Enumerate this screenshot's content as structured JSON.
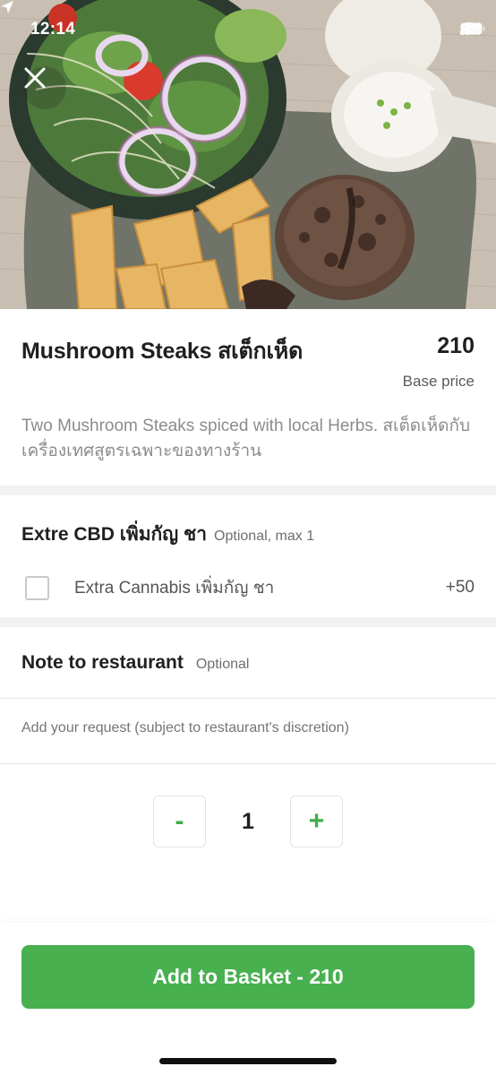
{
  "status_bar": {
    "time": "12:14"
  },
  "item": {
    "title": "Mushroom Steaks สเต็กเห็ด",
    "price": "210",
    "base_price_label": "Base price",
    "description": "Two Mushroom Steaks spiced with local Herbs. สเต็ดเห็ดกับเครื่องเทศสูตรเฉพาะของทางร้าน"
  },
  "option_group": {
    "title": "Extre CBD เพิ่มกัญ ชา",
    "subtitle": "Optional, max 1",
    "options": [
      {
        "label": "Extra Cannabis เพิ่มกัญ ชา",
        "price": "+50",
        "checked": false
      }
    ]
  },
  "note": {
    "title": "Note to restaurant",
    "subtitle": "Optional",
    "placeholder": "Add your request (subject to restaurant's discretion)"
  },
  "quantity": {
    "minus_label": "-",
    "value": "1",
    "plus_label": "+"
  },
  "cta": {
    "label": "Add to Basket - 210"
  },
  "colors": {
    "accent": "#48b04f",
    "accent_text": "#3fae49",
    "divider": "#f2f2f2"
  },
  "icons": {
    "close": "close-icon",
    "location": "location-arrow-icon",
    "signal": "signal-icon",
    "wifi": "wifi-icon",
    "battery": "battery-icon"
  }
}
